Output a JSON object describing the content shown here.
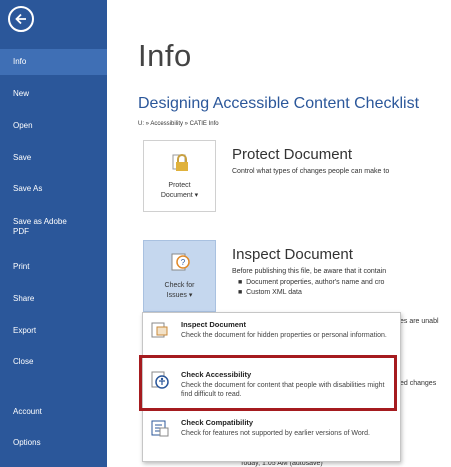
{
  "sidebar": {
    "items": [
      {
        "label": "Info",
        "active": true
      },
      {
        "label": "New"
      },
      {
        "label": "Open"
      },
      {
        "label": "Save"
      },
      {
        "label": "Save As"
      },
      {
        "label": "Save as Adobe PDF"
      },
      {
        "label": "Print"
      },
      {
        "label": "Share"
      },
      {
        "label": "Export"
      },
      {
        "label": "Close"
      },
      {
        "label": "Account"
      },
      {
        "label": "Options"
      }
    ]
  },
  "main": {
    "title": "Info",
    "doc_title": "Designing Accessible Content Checklist",
    "path": "U: » Accessibility » CATIE Info",
    "protect": {
      "tile_label_1": "Protect",
      "tile_label_2": "Document",
      "heading": "Protect Document",
      "desc": "Control what types of changes people can make to"
    },
    "inspect": {
      "tile_label_1": "Check for",
      "tile_label_2": "Issues",
      "heading": "Inspect Document",
      "desc": "Before publishing this file, be aware that it contain",
      "bullets": [
        "Document properties, author's name and cro",
        "Custom XML data"
      ],
      "overflow_1": "es are unabl",
      "overflow_2": "ed changes",
      "overflow_3": "Today, 1:05 AM (autosave)"
    }
  },
  "menu": {
    "items": [
      {
        "title": "Inspect Document",
        "desc": "Check the document for hidden properties or personal information."
      },
      {
        "title": "Check Accessibility",
        "desc": "Check the document for content that people with disabilities might find difficult to read."
      },
      {
        "title": "Check Compatibility",
        "desc": "Check for features not supported by earlier versions of Word."
      }
    ]
  },
  "colors": {
    "sidebar": "#2b579a",
    "accent": "#2b579a",
    "highlight": "#a51b1f"
  }
}
